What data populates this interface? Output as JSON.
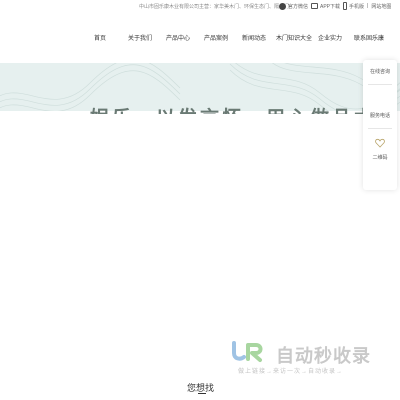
{
  "topbar": {
    "company": "中山市固乐康木业有限公司主营：家华美木门、环保生态门、隔化门",
    "tools": [
      {
        "icon": "wechat-icon",
        "label": "官方微信"
      },
      {
        "icon": "app-icon",
        "label": "APP下载"
      },
      {
        "icon": "phone-icon",
        "label": "手机版"
      },
      {
        "icon": "",
        "label": "网站地图"
      }
    ],
    "divider": "|"
  },
  "nav": {
    "items": [
      "首页",
      "关于我们",
      "产品中心",
      "产品案例",
      "新闻动态",
      "木门知识大全",
      "企业实力",
      "联系固乐康"
    ]
  },
  "banner": {
    "title": "娱乐，以发言怀。用心做品木门",
    "background": "#e6f0ef"
  },
  "float_panel": {
    "items": [
      "在线咨询",
      "服务电话",
      "二维码"
    ],
    "heart_icon": "heart-icon"
  },
  "watermark": {
    "logo": "JR",
    "main": "自动秒收录",
    "sub": "做上链接→来访一次→自动收录→"
  },
  "section": {
    "title": "您想找"
  }
}
